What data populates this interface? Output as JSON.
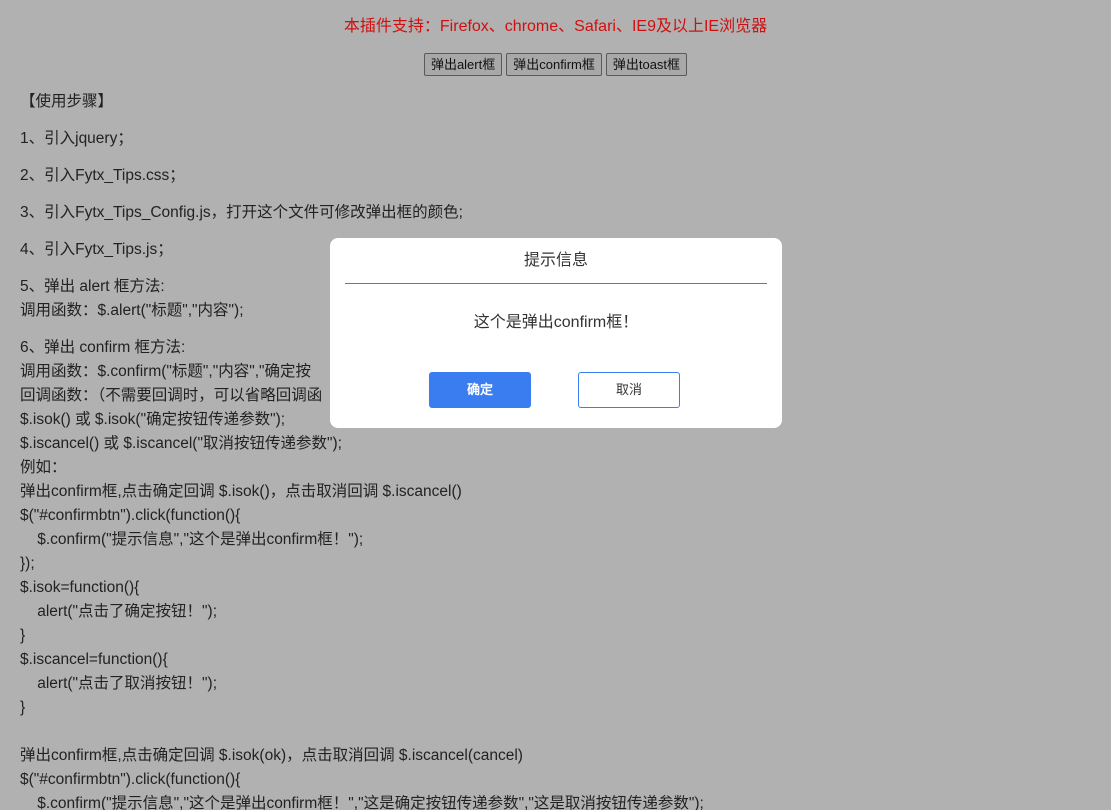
{
  "notice": "本插件支持：Firefox、chrome、Safari、IE9及以上IE浏览器",
  "buttons": {
    "alert": "弹出alert框",
    "confirm": "弹出confirm框",
    "toast": "弹出toast框"
  },
  "steps": {
    "heading": "【使用步骤】",
    "s1": "1、引入jquery；",
    "s2": "2、引入Fytx_Tips.css；",
    "s3": "3、引入Fytx_Tips_Config.js，打开这个文件可修改弹出框的颜色;",
    "s4": "4、引入Fytx_Tips.js；",
    "s5_title": "5、弹出 alert 框方法:",
    "s5_call": "调用函数：$.alert(\"标题\",\"内容\");",
    "s6_title": "6、弹出 confirm 框方法:",
    "s6_call": "调用函数：$.confirm(\"标题\",\"内容\",\"确定按",
    "s6_callback": "回调函数：（不需要回调时，可以省略回调函",
    "s6_isok": "$.isok() 或 $.isok(\"确定按钮传递参数\");",
    "s6_iscancel": "$.iscancel() 或 $.iscancel(\"取消按钮传递参数\");",
    "s6_example": "例如：",
    "ex1_desc": "弹出confirm框,点击确定回调 $.isok()，点击取消回调 $.iscancel()",
    "ex1_l1": "$(\"#confirmbtn\").click(function(){",
    "ex1_l2": "    $.confirm(\"提示信息\",\"这个是弹出confirm框！\");",
    "ex1_l3": "});",
    "ex1_l4": "$.isok=function(){",
    "ex1_l5": "    alert(\"点击了确定按钮！\");",
    "ex1_l6": "}",
    "ex1_l7": "$.iscancel=function(){",
    "ex1_l8": "    alert(\"点击了取消按钮！\");",
    "ex1_l9": "}",
    "ex2_desc": "弹出confirm框,点击确定回调 $.isok(ok)，点击取消回调 $.iscancel(cancel)",
    "ex2_l1": "$(\"#confirmbtn\").click(function(){",
    "ex2_l2": "    $.confirm(\"提示信息\",\"这个是弹出confirm框！\",\"这是确定按钮传递参数\",\"这是取消按钮传递参数\");"
  },
  "dialog": {
    "title": "提示信息",
    "message": "这个是弹出confirm框！",
    "ok_label": "确定",
    "cancel_label": "取消"
  },
  "colors": {
    "backdrop": "#b1b1b1",
    "notice": "#d01010",
    "accent": "#3a7df0"
  }
}
